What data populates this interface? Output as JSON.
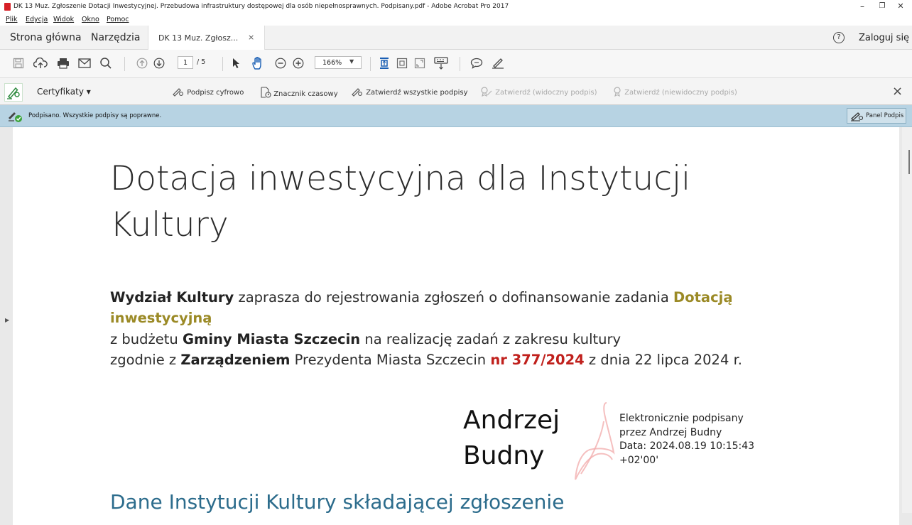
{
  "window": {
    "title": "DK 13 Muz. Zgłoszenie Dotacji Inwestycyjnej. Przebudowa infrastruktury dostępowej dla osób niepełnosprawnych. Podpisany.pdf - Adobe Acrobat Pro 2017",
    "controls": {
      "minimize": "–",
      "restore": "❐",
      "close": "✕"
    }
  },
  "menu": [
    "Plik",
    "Edycja",
    "Widok",
    "Okno",
    "Pomoc"
  ],
  "tabs": {
    "home": "Strona główna",
    "tools": "Narzędzia",
    "document": "DK 13 Muz. Zgłosz...",
    "document_close": "×"
  },
  "account": {
    "help": "?",
    "login": "Zaloguj się"
  },
  "toolbar": {
    "page_current": "1",
    "page_total": "/ 5",
    "zoom": "166%"
  },
  "certificates": {
    "label": "Certyfikaty",
    "tools": [
      {
        "label": "Podpisz cyfrowo",
        "enabled": true
      },
      {
        "label": "Znacznik czasowy",
        "enabled": true
      },
      {
        "label": "Zatwierdź wszystkie podpisy",
        "enabled": true
      },
      {
        "label": "Zatwierdź (widoczny podpis)",
        "enabled": false
      },
      {
        "label": "Zatwierdź (niewidoczny podpis)",
        "enabled": false
      }
    ],
    "close": "×"
  },
  "signature_bar": {
    "message": "Podpisano. Wszystkie podpisy są poprawne.",
    "panel_button": "Panel Podpis"
  },
  "document": {
    "title": "Dotacja inwestycyjna dla Instytucji Kultury",
    "para": {
      "p1a": "Wydział Kultury",
      "p1b": " zaprasza do rejestrowania zgłoszeń o dofinansowanie zadania ",
      "p1c": "Dotacją inwestycyjną",
      "p2a": "z budżetu ",
      "p2b": "Gminy Miasta Szczecin",
      "p2c": " na realizację zadań z zakresu kultury",
      "p3a": "zgodnie z ",
      "p3b": "Zarządzeniem",
      "p3c": " Prezydenta Miasta Szczecin ",
      "p3d": "nr 377/2024",
      "p3e": " z dnia 22 lipca 2024 r."
    },
    "signature": {
      "first": "Andrzej",
      "last": "Budny",
      "l1": "Elektronicznie podpisany",
      "l2": "przez Andrzej Budny",
      "l3": "Data: 2024.08.19 10:15:43",
      "l4": "+02'00'"
    },
    "section_heading": "Dane Instytucji Kultury składającej zgłoszenie"
  },
  "colors": {
    "accent_gold": "#9b8a26",
    "accent_red": "#c0201c",
    "heading_blue": "#2c6c8c",
    "sigbar_bg": "#b7d3e3"
  }
}
